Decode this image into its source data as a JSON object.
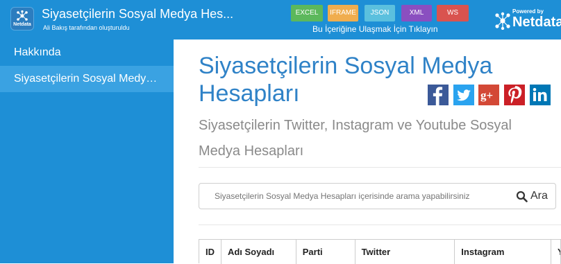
{
  "header": {
    "logo_text": "Netdata",
    "title": "Siyasetçilerin Sosyal Medya Hes...",
    "subtitle": "Ali Bakış tarafından oluşturuldu",
    "exports": [
      "EXCEL",
      "IFRAME",
      "JSON",
      "XML",
      "WS"
    ],
    "export_note": "Bu İçeriğine Ulaşmak İçin Tıklayın",
    "powered_by": "Powered by",
    "brand": "Netdata"
  },
  "sidebar": {
    "items": [
      {
        "label": "Hakkında",
        "active": false
      },
      {
        "label": "Siyasetçilerin Sosyal Medya Hesapları",
        "active": true
      }
    ]
  },
  "main": {
    "title": "Siyasetçilerin Sosyal Medya Hesapları",
    "subtitle": "Siyasetçilerin Twitter, Instagram ve Youtube Sosyal Medya Hesapları",
    "social_icons": [
      "facebook-icon",
      "twitter-icon",
      "google-plus-icon",
      "pinterest-icon",
      "linkedin-icon"
    ],
    "search": {
      "placeholder": "Siyasetçilerin Sosyal Medya Hesapları içerisinde arama yapabilirsiniz",
      "button": "Ara"
    },
    "table": {
      "columns": [
        "ID",
        "Adı Soyadı",
        "Parti",
        "Twitter",
        "Instagram",
        "Y"
      ]
    }
  },
  "colors": {
    "primary": "#1e8fd6",
    "active_item": "#3aa2e2",
    "title": "#2f82c7",
    "subtitle": "#8a8a8a"
  }
}
